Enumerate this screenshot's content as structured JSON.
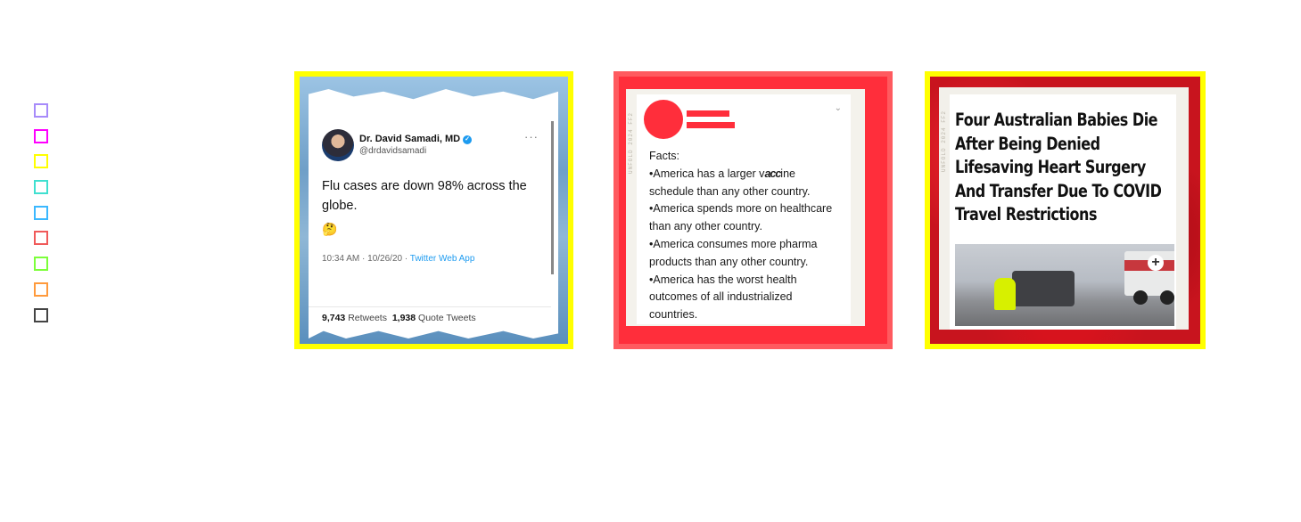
{
  "palette": {
    "swatches": [
      {
        "name": "violet",
        "color": "#a78bfa"
      },
      {
        "name": "magenta",
        "color": "#ff00ff"
      },
      {
        "name": "yellow",
        "color": "#ffff00"
      },
      {
        "name": "turquoise",
        "color": "#40e0d0"
      },
      {
        "name": "sky-blue",
        "color": "#3bb8ff"
      },
      {
        "name": "coral",
        "color": "#f05a5a"
      },
      {
        "name": "lime",
        "color": "#7cff3a"
      },
      {
        "name": "orange",
        "color": "#ff9a3c"
      },
      {
        "name": "dark-gray",
        "color": "#444444"
      }
    ]
  },
  "cards": {
    "tweet": {
      "border_color": "#ffff00",
      "author_name": "Dr. David Samadi, MD",
      "handle": "@drdavidsamadi",
      "verified_mark": "✓",
      "more_icon": "···",
      "text": "Flu cases are down 98% across the globe.",
      "emoji": "🤔",
      "timestamp": "10:34 AM · 10/26/20 · ",
      "source": "Twitter Web App",
      "retweets_count": "9,743",
      "retweets_label": "Retweets",
      "quotes_count": "1,938",
      "quotes_label": "Quote Tweets"
    },
    "facts": {
      "border_color": "#ff5a5f",
      "side_label": "UNFOLD 2024 FF2",
      "chevron": "⌄",
      "heading": "Facts:",
      "line1_pre": "•America has a larger v",
      "line1_scribble": "acc",
      "line1_post": "ine",
      "lines": [
        "schedule than any other country.",
        "•America spends more on healthcare",
        "than any other country.",
        "•America consumes more pharma",
        "products than any other country.",
        "•America has the worst health",
        "outcomes of all industrialized",
        "countries."
      ]
    },
    "headline": {
      "border_color": "#ffff00",
      "side_label": "UNFOLD 2024 FF2",
      "title": "Four Australian Babies Die After Being Denied Lifesaving Heart Surgery And Transfer Due To COVID Travel Restrictions",
      "expand_icon": "+"
    }
  }
}
